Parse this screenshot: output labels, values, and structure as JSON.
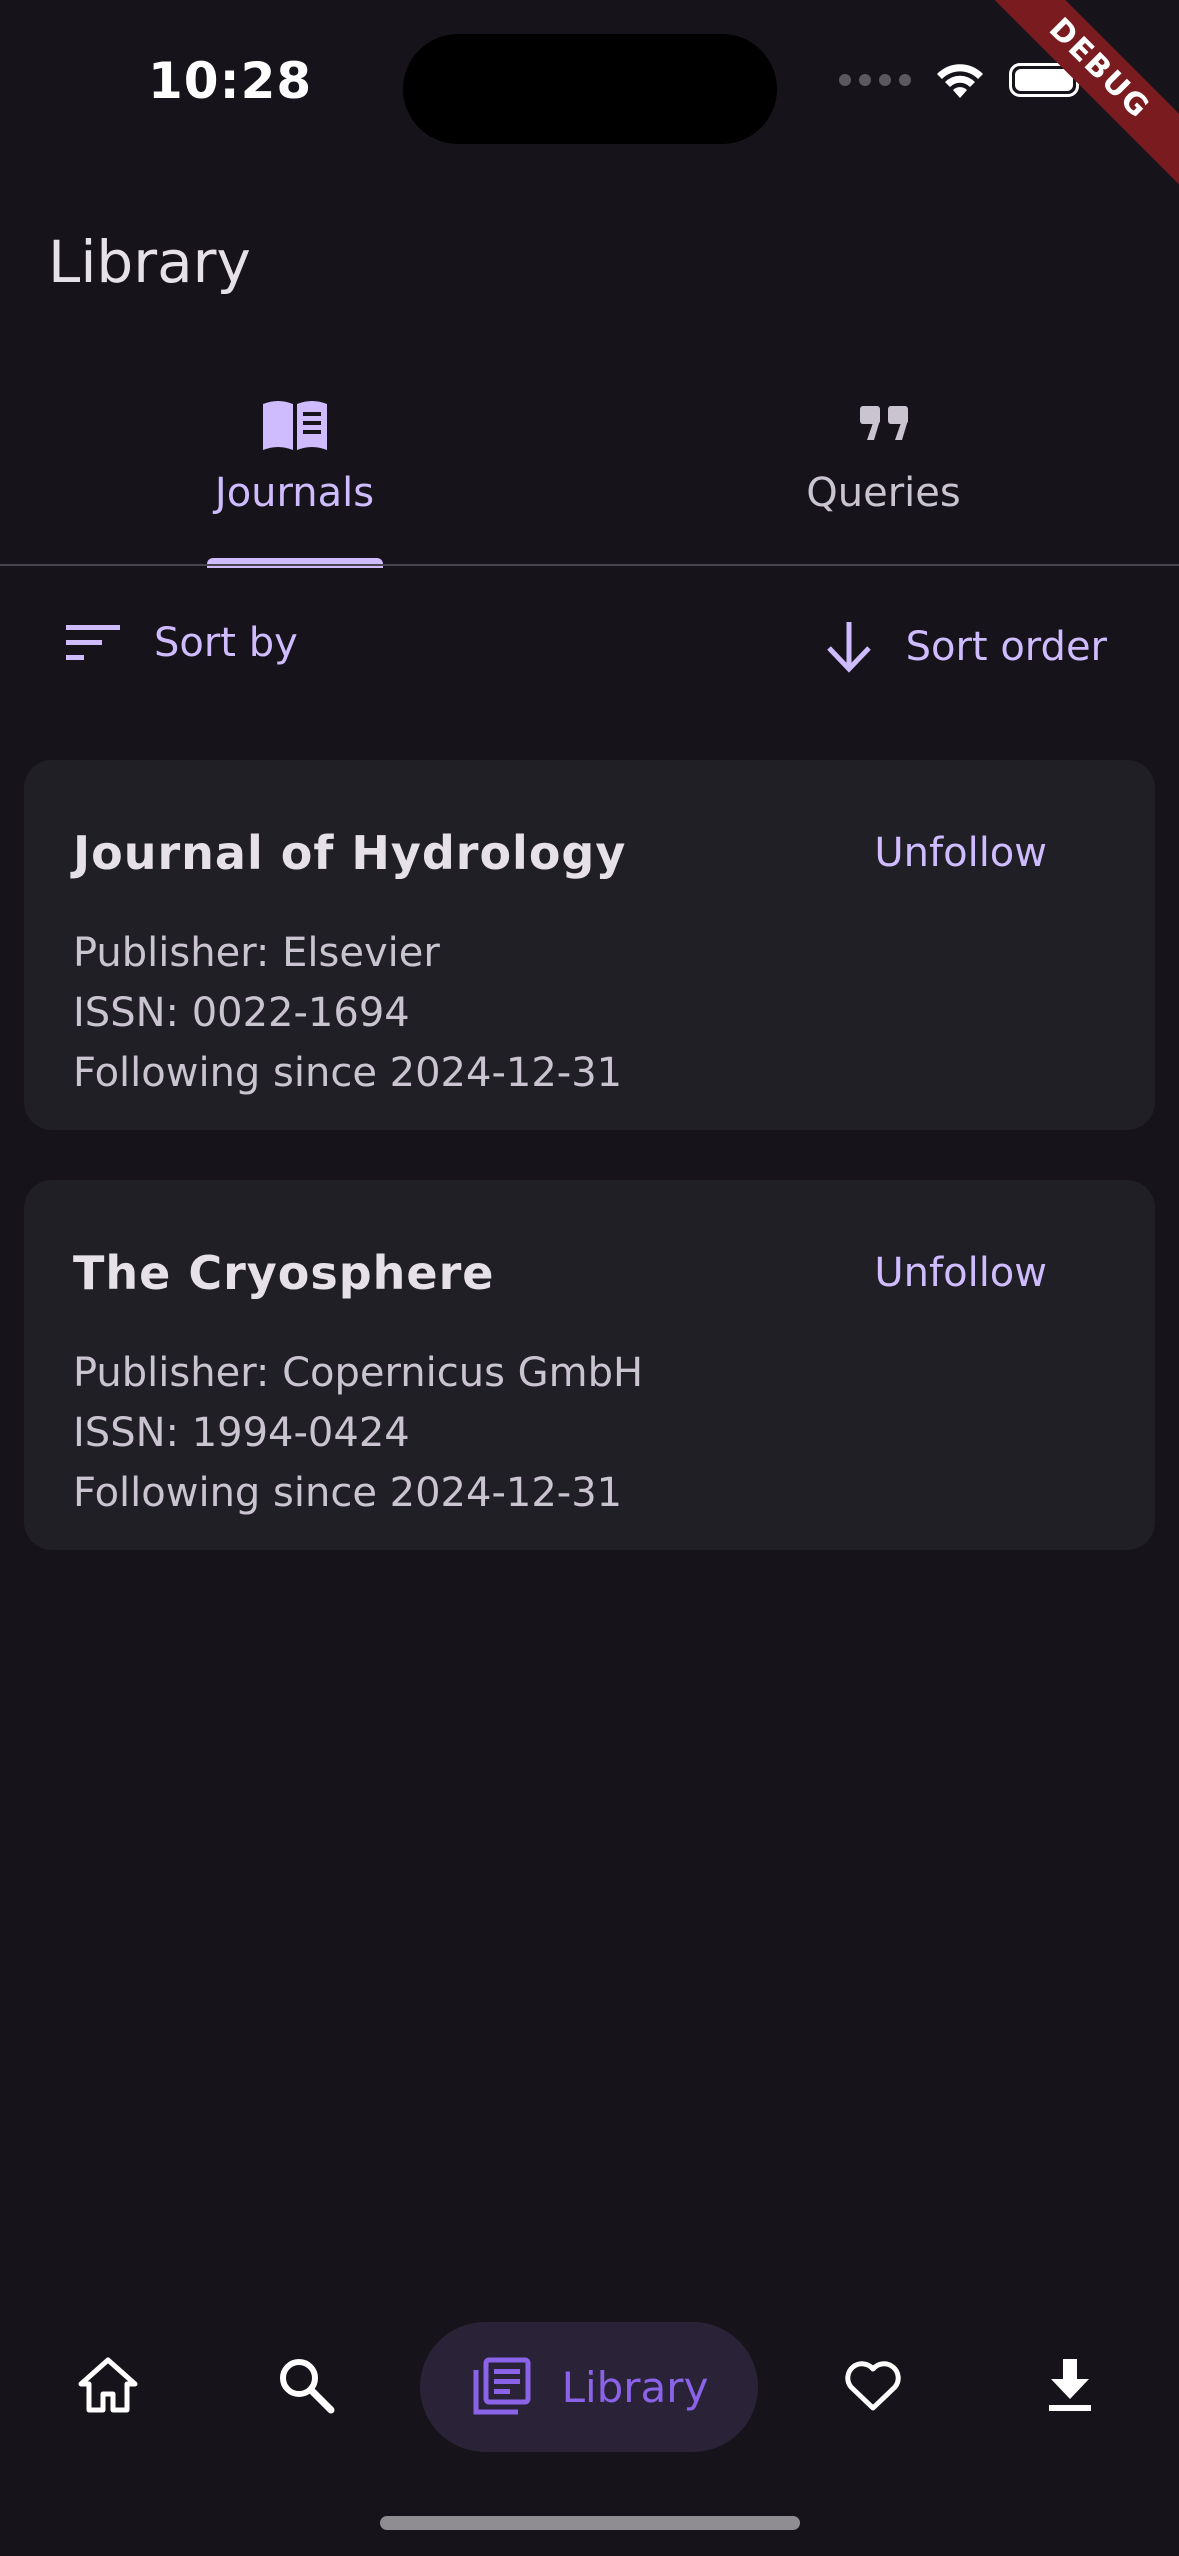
{
  "status_bar": {
    "time": "10:28"
  },
  "debug_banner": "DEBUG",
  "app_bar": {
    "title": "Library"
  },
  "tabs": [
    {
      "label": "Journals",
      "icon": "open-book-icon",
      "selected": true
    },
    {
      "label": "Queries",
      "icon": "quote-icon",
      "selected": false
    }
  ],
  "sort": {
    "sort_by_label": "Sort by",
    "sort_order_label": "Sort order"
  },
  "journals": [
    {
      "title": "Journal of Hydrology",
      "action": "Unfollow",
      "publisher": "Publisher: Elsevier",
      "issn": "ISSN: 0022-1694",
      "following": "Following since 2024-12-31"
    },
    {
      "title": "The Cryosphere",
      "action": "Unfollow",
      "publisher": "Publisher: Copernicus GmbH",
      "issn": "ISSN: 1994-0424",
      "following": "Following since 2024-12-31"
    }
  ],
  "bottom_nav": {
    "items": [
      "home-icon",
      "search-icon",
      "library-icon",
      "heart-icon",
      "download-icon"
    ],
    "active_label": "Library"
  },
  "colors": {
    "background": "#16141a",
    "accent": "#cfbcff",
    "card": "#211f26",
    "active_nav": "#8a63e8"
  }
}
